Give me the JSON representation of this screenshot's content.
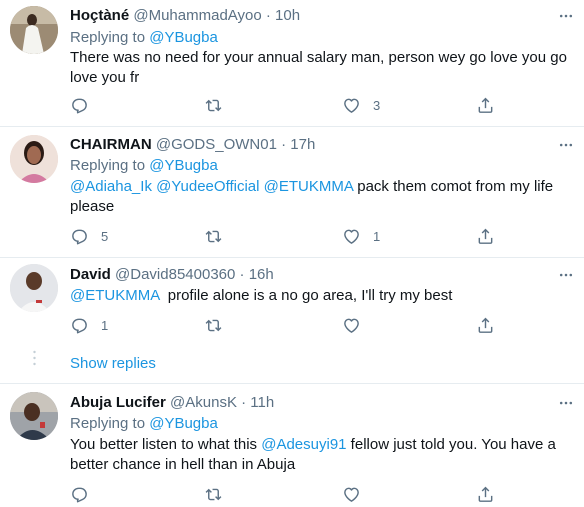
{
  "tweets": [
    {
      "name": "Hoçtàné",
      "handle": "@MuhammadAyoo",
      "time": "10h",
      "replying_prefix": "Replying to ",
      "replying_to": "@YBugba",
      "text": "There was no need for your annual salary man, person wey go love you go love you fr",
      "reply_count": "",
      "like_count": "3"
    },
    {
      "name": "CHAIRMAN",
      "handle": "@GODS_OWN01",
      "time": "17h",
      "replying_prefix": "Replying to ",
      "replying_to": "@YBugba",
      "mentions": [
        "@Adiaha_Ik",
        "@YudeeOfficial",
        "@ETUKMMA"
      ],
      "text": " pack them comot from my life please",
      "reply_count": "5",
      "like_count": "1"
    },
    {
      "name": "David",
      "handle": "@David85400360",
      "time": "16h",
      "mention": "@ETUKMMA",
      "text": "  profile alone is a no go area, I'll try my best",
      "reply_count": "1",
      "like_count": ""
    },
    {
      "name": "Abuja Lucifer",
      "handle": "@AkunsK",
      "time": "11h",
      "replying_prefix": "Replying to ",
      "replying_to": "@YBugba",
      "text_before": "You better listen to what this ",
      "mention": "@Adesuyi91",
      "text_after": " fellow just told you. You have a better chance in hell than in Abuja",
      "reply_count": "",
      "like_count": ""
    }
  ],
  "show_replies": "Show replies",
  "dot": "·",
  "colors": {
    "link": "#1b95e0",
    "muted": "#5b7083",
    "separator": "#e6ecf0"
  },
  "icons": [
    "more-icon",
    "reply-icon",
    "retweet-icon",
    "like-icon",
    "share-icon"
  ]
}
